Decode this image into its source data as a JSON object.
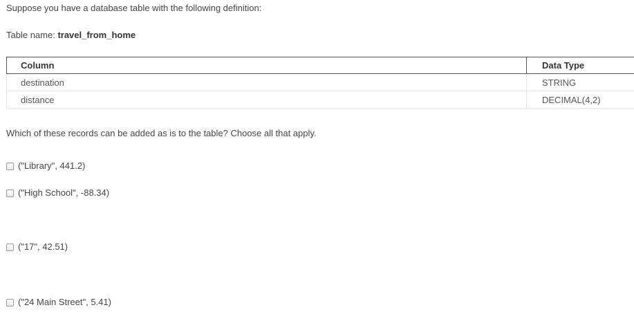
{
  "intro_text": "Suppose you have a database table with the following definition:",
  "table_name_label": "Table name: ",
  "table_name_value": "travel_from_home",
  "table": {
    "headers": [
      "Column",
      "Data Type"
    ],
    "rows": [
      {
        "column": "destination",
        "type": "STRING"
      },
      {
        "column": "distance",
        "type": "DECIMAL(4,2)"
      }
    ]
  },
  "question": "Which of these records can be added as is to the table? Choose all that apply.",
  "options": [
    {
      "label": "(\"Library\", 441.2)",
      "checked": false
    },
    {
      "label": "(\"High School\", -88.34)",
      "checked": false
    },
    {
      "label": "(\"17\", 42.51)",
      "checked": false
    },
    {
      "label": "(\"24 Main Street\", 5.41)",
      "checked": false
    }
  ]
}
